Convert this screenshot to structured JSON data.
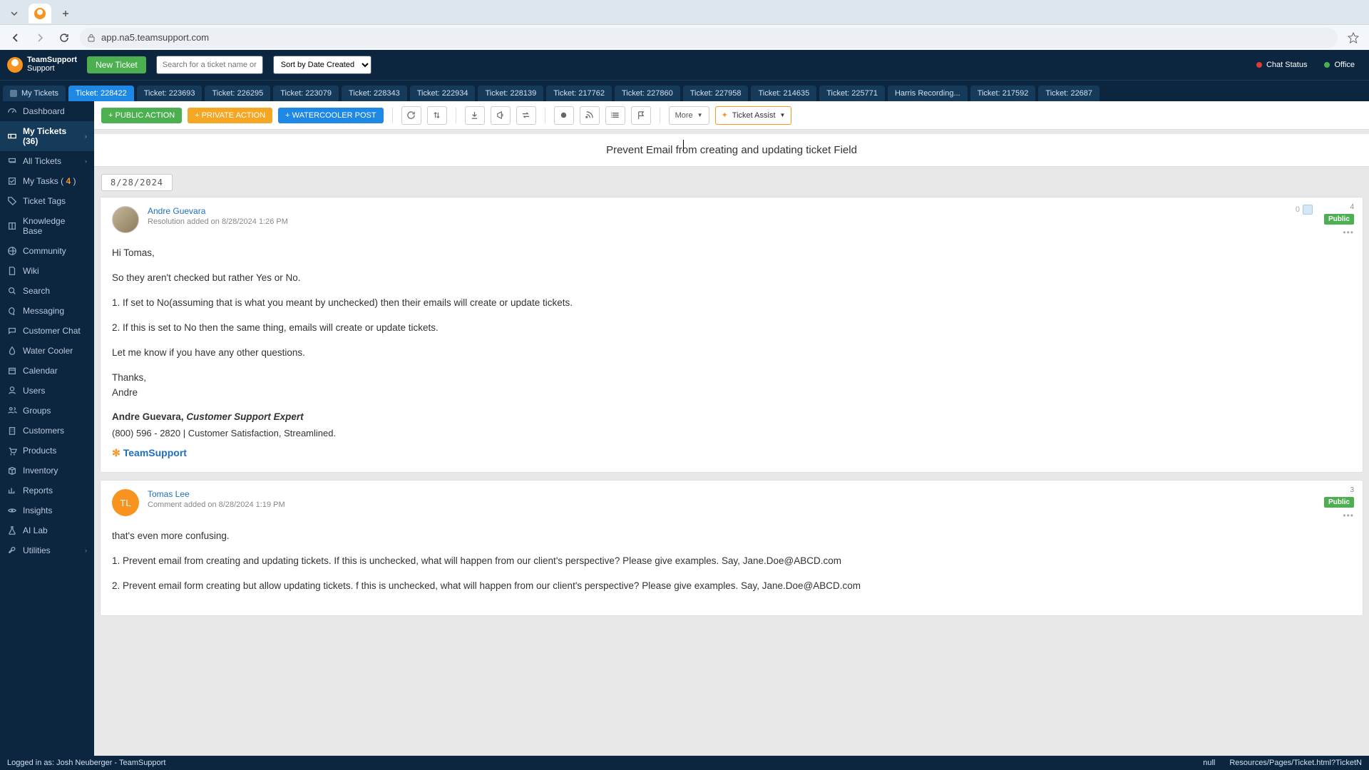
{
  "browser": {
    "url": "app.na5.teamsupport.com"
  },
  "header": {
    "brand_line1": "TeamSupport",
    "brand_line2": "Support",
    "new_ticket_label": "New Ticket",
    "search_placeholder": "Search for a ticket name or #",
    "sort_label": "Sort by Date Created",
    "chat_status_label": "Chat Status",
    "office_label": "Office"
  },
  "ticket_tabs": [
    {
      "label": "My Tickets",
      "active": false,
      "icon": true
    },
    {
      "label": "Ticket: 228422",
      "active": true
    },
    {
      "label": "Ticket: 223693"
    },
    {
      "label": "Ticket: 226295"
    },
    {
      "label": "Ticket: 223079"
    },
    {
      "label": "Ticket: 228343"
    },
    {
      "label": "Ticket: 222934"
    },
    {
      "label": "Ticket: 228139"
    },
    {
      "label": "Ticket: 217762"
    },
    {
      "label": "Ticket: 227860"
    },
    {
      "label": "Ticket: 227958"
    },
    {
      "label": "Ticket: 214635"
    },
    {
      "label": "Ticket: 225771"
    },
    {
      "label": "Harris Recording..."
    },
    {
      "label": "Ticket: 217592"
    },
    {
      "label": "Ticket: 22687"
    }
  ],
  "sidebar": [
    {
      "label": "Dashboard",
      "icon": "gauge"
    },
    {
      "label": "My Tickets (36)",
      "icon": "ticket",
      "active": true,
      "chevron": true
    },
    {
      "label": "All Tickets",
      "icon": "tickets",
      "chevron": true
    },
    {
      "label_html": "My Tasks ( <span class='badge-orange'>4</span> )",
      "label": "My Tasks ( 4 )",
      "icon": "check"
    },
    {
      "label": "Ticket Tags",
      "icon": "tag"
    },
    {
      "label": "Knowledge Base",
      "icon": "book"
    },
    {
      "label": "Community",
      "icon": "globe"
    },
    {
      "label": "Wiki",
      "icon": "doc"
    },
    {
      "label": "Search",
      "icon": "search"
    },
    {
      "label": "Messaging",
      "icon": "chat"
    },
    {
      "label": "Customer Chat",
      "icon": "bubble"
    },
    {
      "label": "Water Cooler",
      "icon": "drop"
    },
    {
      "label": "Calendar",
      "icon": "cal"
    },
    {
      "label": "Users",
      "icon": "user"
    },
    {
      "label": "Groups",
      "icon": "users"
    },
    {
      "label": "Customers",
      "icon": "building"
    },
    {
      "label": "Products",
      "icon": "cart"
    },
    {
      "label": "Inventory",
      "icon": "box"
    },
    {
      "label": "Reports",
      "icon": "bar"
    },
    {
      "label": "Insights",
      "icon": "eye"
    },
    {
      "label": "AI Lab",
      "icon": "flask"
    },
    {
      "label": "Utilities",
      "icon": "wrench",
      "chevron": true
    }
  ],
  "toolbar": {
    "public_action": "+ PUBLIC ACTION",
    "private_action": "+ PRIVATE ACTION",
    "watercooler": "+ WATERCOOLER POST",
    "more_label": "More",
    "ticket_assist_label": "Ticket Assist"
  },
  "ticket": {
    "title": "Prevent Email from creating and updating ticket Field",
    "date_group": "8/28/2024"
  },
  "messages": [
    {
      "author": "Andre Guevara",
      "subline": "Resolution added on 8/28/2024 1:26 PM",
      "avatar": "img",
      "likes": "0",
      "count": "4",
      "badge": "Public",
      "body": [
        "Hi Tomas,",
        "So they aren't checked but rather Yes or No.",
        "1. If  set to No(assuming that is what you meant by unchecked) then their emails will create or update tickets.",
        "2. If this is set to No then the same thing, emails will create or update tickets.",
        "Let me know if you have any other questions.",
        "Thanks,\nAndre"
      ],
      "signature": {
        "name": "Andre Guevara,",
        "title": "Customer Support Expert",
        "phone": "(800) 596 - 2820 | Customer Satisfaction, Streamlined.",
        "logo": "TeamSupport"
      }
    },
    {
      "author": "Tomas Lee",
      "subline": "Comment added on 8/28/2024 1:19 PM",
      "avatar": "TL",
      "count": "3",
      "badge": "Public",
      "body": [
        "that's even more confusing.",
        "1. Prevent email from creating and updating tickets. If this is unchecked, what will happen from our client's perspective? Please give examples. Say, Jane.Doe@ABCD.com",
        "2. Prevent email form creating but allow updating tickets.  f this is unchecked, what will happen from our client's perspective? Please give examples.   Say, Jane.Doe@ABCD.com"
      ]
    }
  ],
  "statusbar": {
    "logged_in": "Logged in as: Josh Neuberger - TeamSupport",
    "null_label": "null",
    "path": "Resources/Pages/Ticket.html?TicketN"
  }
}
